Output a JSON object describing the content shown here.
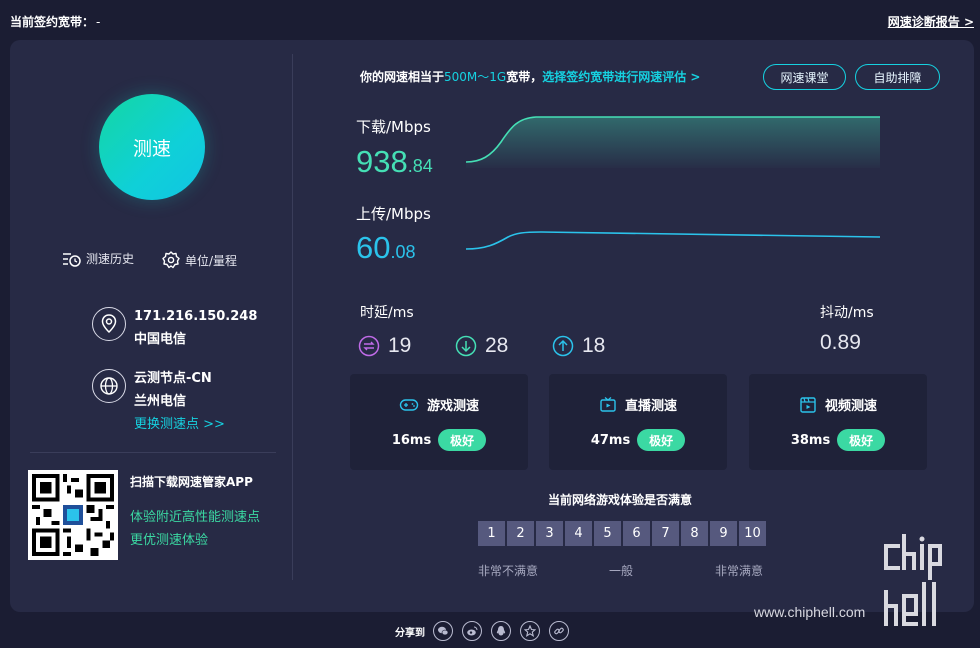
{
  "top": {
    "contract_label": "当前签约宽带：",
    "contract_value": "-",
    "report_link": "网速诊断报告 >"
  },
  "left": {
    "speed_button": "测速",
    "history_label": "测速历史",
    "unit_label": "单位/量程",
    "ip_address": "171.216.150.248",
    "isp": "中国电信",
    "node_name": "云测节点-CN",
    "node_city": "兰州电信",
    "change_node": "更换测速点 >>",
    "qr_title": "扫描下载网速管家APP",
    "qr_line1": "体验附近高性能测速点",
    "qr_line2": "更优测速体验"
  },
  "header": {
    "equiv_prefix": "你的网速相当于",
    "equiv_range": "500M～1G",
    "equiv_suffix": "宽带，",
    "equiv_link": "选择签约宽带进行网速评估 >",
    "btn_lesson": "网速课堂",
    "btn_self": "自助排障"
  },
  "download": {
    "label": "下载/Mbps",
    "int": "938",
    "dec": ".84"
  },
  "upload": {
    "label": "上传/Mbps",
    "int": "60",
    "dec": ".08"
  },
  "latency": {
    "label": "时延/ms",
    "values": [
      "19",
      "28",
      "18"
    ],
    "jitter_label": "抖动/ms",
    "jitter_value": "0.89"
  },
  "cards": [
    {
      "title": "游戏测速",
      "ms": "16ms",
      "badge": "极好",
      "icon": "gamepad-icon"
    },
    {
      "title": "直播测速",
      "ms": "47ms",
      "badge": "极好",
      "icon": "tv-icon"
    },
    {
      "title": "视频测速",
      "ms": "38ms",
      "badge": "极好",
      "icon": "film-icon"
    }
  ],
  "satisfaction": {
    "question": "当前网络游戏体验是否满意",
    "scale": [
      "1",
      "2",
      "3",
      "4",
      "5",
      "6",
      "7",
      "8",
      "9",
      "10"
    ],
    "low": "非常不满意",
    "mid": "一般",
    "high": "非常满意"
  },
  "share": {
    "label": "分享到",
    "icons": [
      "wechat-icon",
      "weibo-icon",
      "qq-icon",
      "qzone-icon",
      "link-icon"
    ]
  },
  "watermark": {
    "url": "www.chiphell.com",
    "logo_text": "chiphell"
  },
  "colors": {
    "background": "#1b1d33",
    "panel": "#272a45",
    "download": "#45dfb5",
    "upload": "#2bc3eb",
    "accent": "#16d1e0",
    "badge": "#3bd9a3"
  }
}
